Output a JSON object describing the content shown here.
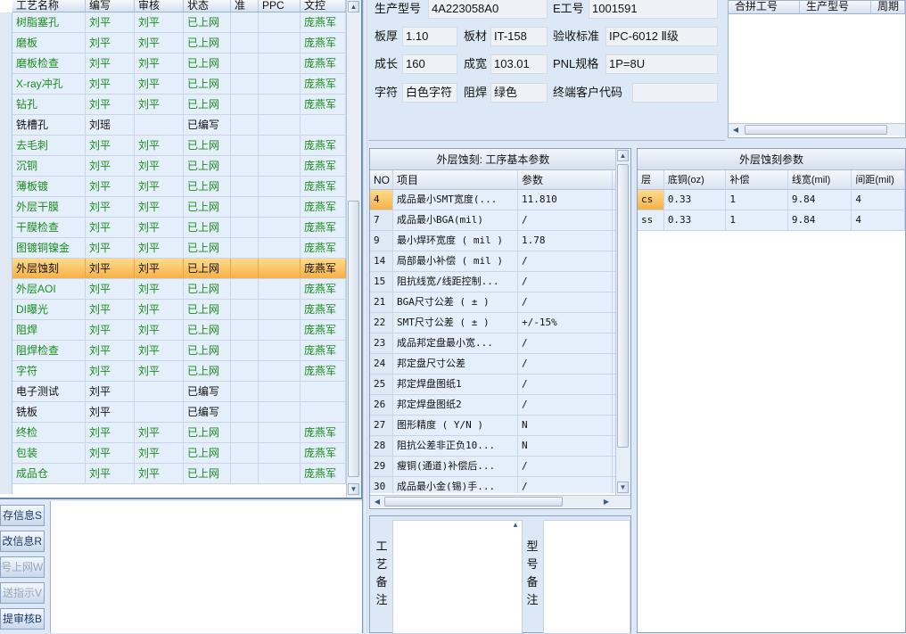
{
  "left_grid": {
    "columns": [
      "工艺名称",
      "编写",
      "审核",
      "状态",
      "准",
      "PPC",
      "文控"
    ],
    "rows": [
      {
        "name": "树脂塞孔",
        "writer": "刘平",
        "reviewer": "刘平",
        "status": "已上网",
        "zhun": "",
        "ppc": "",
        "control": "庞燕军"
      },
      {
        "name": "磨板",
        "writer": "刘平",
        "reviewer": "刘平",
        "status": "已上网",
        "zhun": "",
        "ppc": "",
        "control": "庞燕军"
      },
      {
        "name": "磨板检查",
        "writer": "刘平",
        "reviewer": "刘平",
        "status": "已上网",
        "zhun": "",
        "ppc": "",
        "control": "庞燕军"
      },
      {
        "name": "X-ray冲孔",
        "writer": "刘平",
        "reviewer": "刘平",
        "status": "已上网",
        "zhun": "",
        "ppc": "",
        "control": "庞燕军"
      },
      {
        "name": "钻孔",
        "writer": "刘平",
        "reviewer": "刘平",
        "status": "已上网",
        "zhun": "",
        "ppc": "",
        "control": "庞燕军"
      },
      {
        "name": "铣槽孔",
        "writer": "刘瑶",
        "reviewer": "",
        "status": "已编写",
        "zhun": "",
        "ppc": "",
        "control": ""
      },
      {
        "name": "去毛刺",
        "writer": "刘平",
        "reviewer": "刘平",
        "status": "已上网",
        "zhun": "",
        "ppc": "",
        "control": "庞燕军"
      },
      {
        "name": "沉铜",
        "writer": "刘平",
        "reviewer": "刘平",
        "status": "已上网",
        "zhun": "",
        "ppc": "",
        "control": "庞燕军"
      },
      {
        "name": "薄板镀",
        "writer": "刘平",
        "reviewer": "刘平",
        "status": "已上网",
        "zhun": "",
        "ppc": "",
        "control": "庞燕军"
      },
      {
        "name": "外层干膜",
        "writer": "刘平",
        "reviewer": "刘平",
        "status": "已上网",
        "zhun": "",
        "ppc": "",
        "control": "庞燕军"
      },
      {
        "name": "干膜检查",
        "writer": "刘平",
        "reviewer": "刘平",
        "status": "已上网",
        "zhun": "",
        "ppc": "",
        "control": "庞燕军"
      },
      {
        "name": "图镀铜镍金",
        "writer": "刘平",
        "reviewer": "刘平",
        "status": "已上网",
        "zhun": "",
        "ppc": "",
        "control": "庞燕军"
      },
      {
        "name": "外层蚀刻",
        "writer": "刘平",
        "reviewer": "刘平",
        "status": "已上网",
        "zhun": "",
        "ppc": "",
        "control": "庞燕军",
        "selected": true
      },
      {
        "name": "外层AOI",
        "writer": "刘平",
        "reviewer": "刘平",
        "status": "已上网",
        "zhun": "",
        "ppc": "",
        "control": "庞燕军"
      },
      {
        "name": "DI曝光",
        "writer": "刘平",
        "reviewer": "刘平",
        "status": "已上网",
        "zhun": "",
        "ppc": "",
        "control": "庞燕军"
      },
      {
        "name": "阻焊",
        "writer": "刘平",
        "reviewer": "刘平",
        "status": "已上网",
        "zhun": "",
        "ppc": "",
        "control": "庞燕军"
      },
      {
        "name": "阻焊检查",
        "writer": "刘平",
        "reviewer": "刘平",
        "status": "已上网",
        "zhun": "",
        "ppc": "",
        "control": "庞燕军"
      },
      {
        "name": "字符",
        "writer": "刘平",
        "reviewer": "刘平",
        "status": "已上网",
        "zhun": "",
        "ppc": "",
        "control": "庞燕军"
      },
      {
        "name": "电子测试",
        "writer": "刘平",
        "reviewer": "",
        "status": "已编写",
        "zhun": "",
        "ppc": "",
        "control": ""
      },
      {
        "name": "铣板",
        "writer": "刘平",
        "reviewer": "",
        "status": "已编写",
        "zhun": "",
        "ppc": "",
        "control": ""
      },
      {
        "name": "终检",
        "writer": "刘平",
        "reviewer": "刘平",
        "status": "已上网",
        "zhun": "",
        "ppc": "",
        "control": "庞燕军"
      },
      {
        "name": "包装",
        "writer": "刘平",
        "reviewer": "刘平",
        "status": "已上网",
        "zhun": "",
        "ppc": "",
        "control": "庞燕军"
      },
      {
        "name": "成品仓",
        "writer": "刘平",
        "reviewer": "刘平",
        "status": "已上网",
        "zhun": "",
        "ppc": "",
        "control": "庞燕军"
      }
    ]
  },
  "side_buttons": [
    {
      "label": "存信息S",
      "enabled": true
    },
    {
      "label": "改信息R",
      "enabled": true
    },
    {
      "label": "号上网W",
      "enabled": false
    },
    {
      "label": "送指示V",
      "enabled": false
    },
    {
      "label": "提审核B",
      "enabled": true
    }
  ],
  "info": {
    "model_label": "生产型号",
    "model_value": "4A223058A0",
    "eno_label": "E工号",
    "eno_value": "1001591",
    "thickness_label": "板厚",
    "thickness_value": "1.10",
    "material_label": "板材",
    "material_value": "IT-158",
    "standard_label": "验收标准",
    "standard_value": "IPC-6012 Ⅱ级",
    "length_label": "成长",
    "length_value": "160",
    "width_label": "成宽",
    "width_value": "103.01",
    "pnl_label": "PNL规格",
    "pnl_value": "1P=8U",
    "char_label": "字符",
    "char_value": "白色字符",
    "mask_label": "阻焊",
    "mask_value": "绿色",
    "customer_label": "终端客户代码",
    "customer_value": ""
  },
  "merge_grid": {
    "columns": [
      "合拼工号",
      "生产型号",
      "周期"
    ]
  },
  "param_panel": {
    "title": "外层蚀刻: 工序基本参数",
    "columns": [
      "NO",
      "项目",
      "参数"
    ],
    "rows": [
      {
        "no": "4",
        "item": "成品最小SMT宽度(...",
        "value": "11.810"
      },
      {
        "no": "7",
        "item": "成品最小BGA(mil)",
        "value": "/"
      },
      {
        "no": "9",
        "item": "最小焊环宽度 ( mil )",
        "value": "1.78"
      },
      {
        "no": "14",
        "item": "局部最小补偿 ( mil )",
        "value": "/"
      },
      {
        "no": "15",
        "item": "阻抗线宽/线距控制...",
        "value": "/"
      },
      {
        "no": "21",
        "item": "BGA尺寸公差 ( ± )",
        "value": "/"
      },
      {
        "no": "22",
        "item": "SMT尺寸公差 ( ± )",
        "value": "+/-15%"
      },
      {
        "no": "23",
        "item": "成品邦定盘最小宽...",
        "value": "/"
      },
      {
        "no": "24",
        "item": "邦定盘尺寸公差",
        "value": "/"
      },
      {
        "no": "25",
        "item": "邦定焊盘图纸1",
        "value": "/"
      },
      {
        "no": "26",
        "item": "邦定焊盘图纸2",
        "value": "/"
      },
      {
        "no": "27",
        "item": "图形精度 ( Y/N )",
        "value": "N"
      },
      {
        "no": "28",
        "item": "阻抗公差非正负10...",
        "value": "N"
      },
      {
        "no": "29",
        "item": "瘦铜(通道)补偿后...",
        "value": "/"
      },
      {
        "no": "30",
        "item": "成品最小金(锡)手...",
        "value": "/"
      }
    ]
  },
  "etch_panel": {
    "title": "外层蚀刻参数",
    "columns": [
      "层",
      "底铜(oz)",
      "补偿",
      "线宽(mil)",
      "间距(mil)"
    ],
    "rows": [
      {
        "layer": "cs",
        "base": "0.33",
        "comp": "1",
        "width": "9.84",
        "gap": "4"
      },
      {
        "layer": "ss",
        "base": "0.33",
        "comp": "1",
        "width": "9.84",
        "gap": "4"
      }
    ]
  },
  "notes": {
    "process_label": "工艺备注",
    "model_label": "型号备注",
    "process_text": "",
    "model_text": ""
  }
}
